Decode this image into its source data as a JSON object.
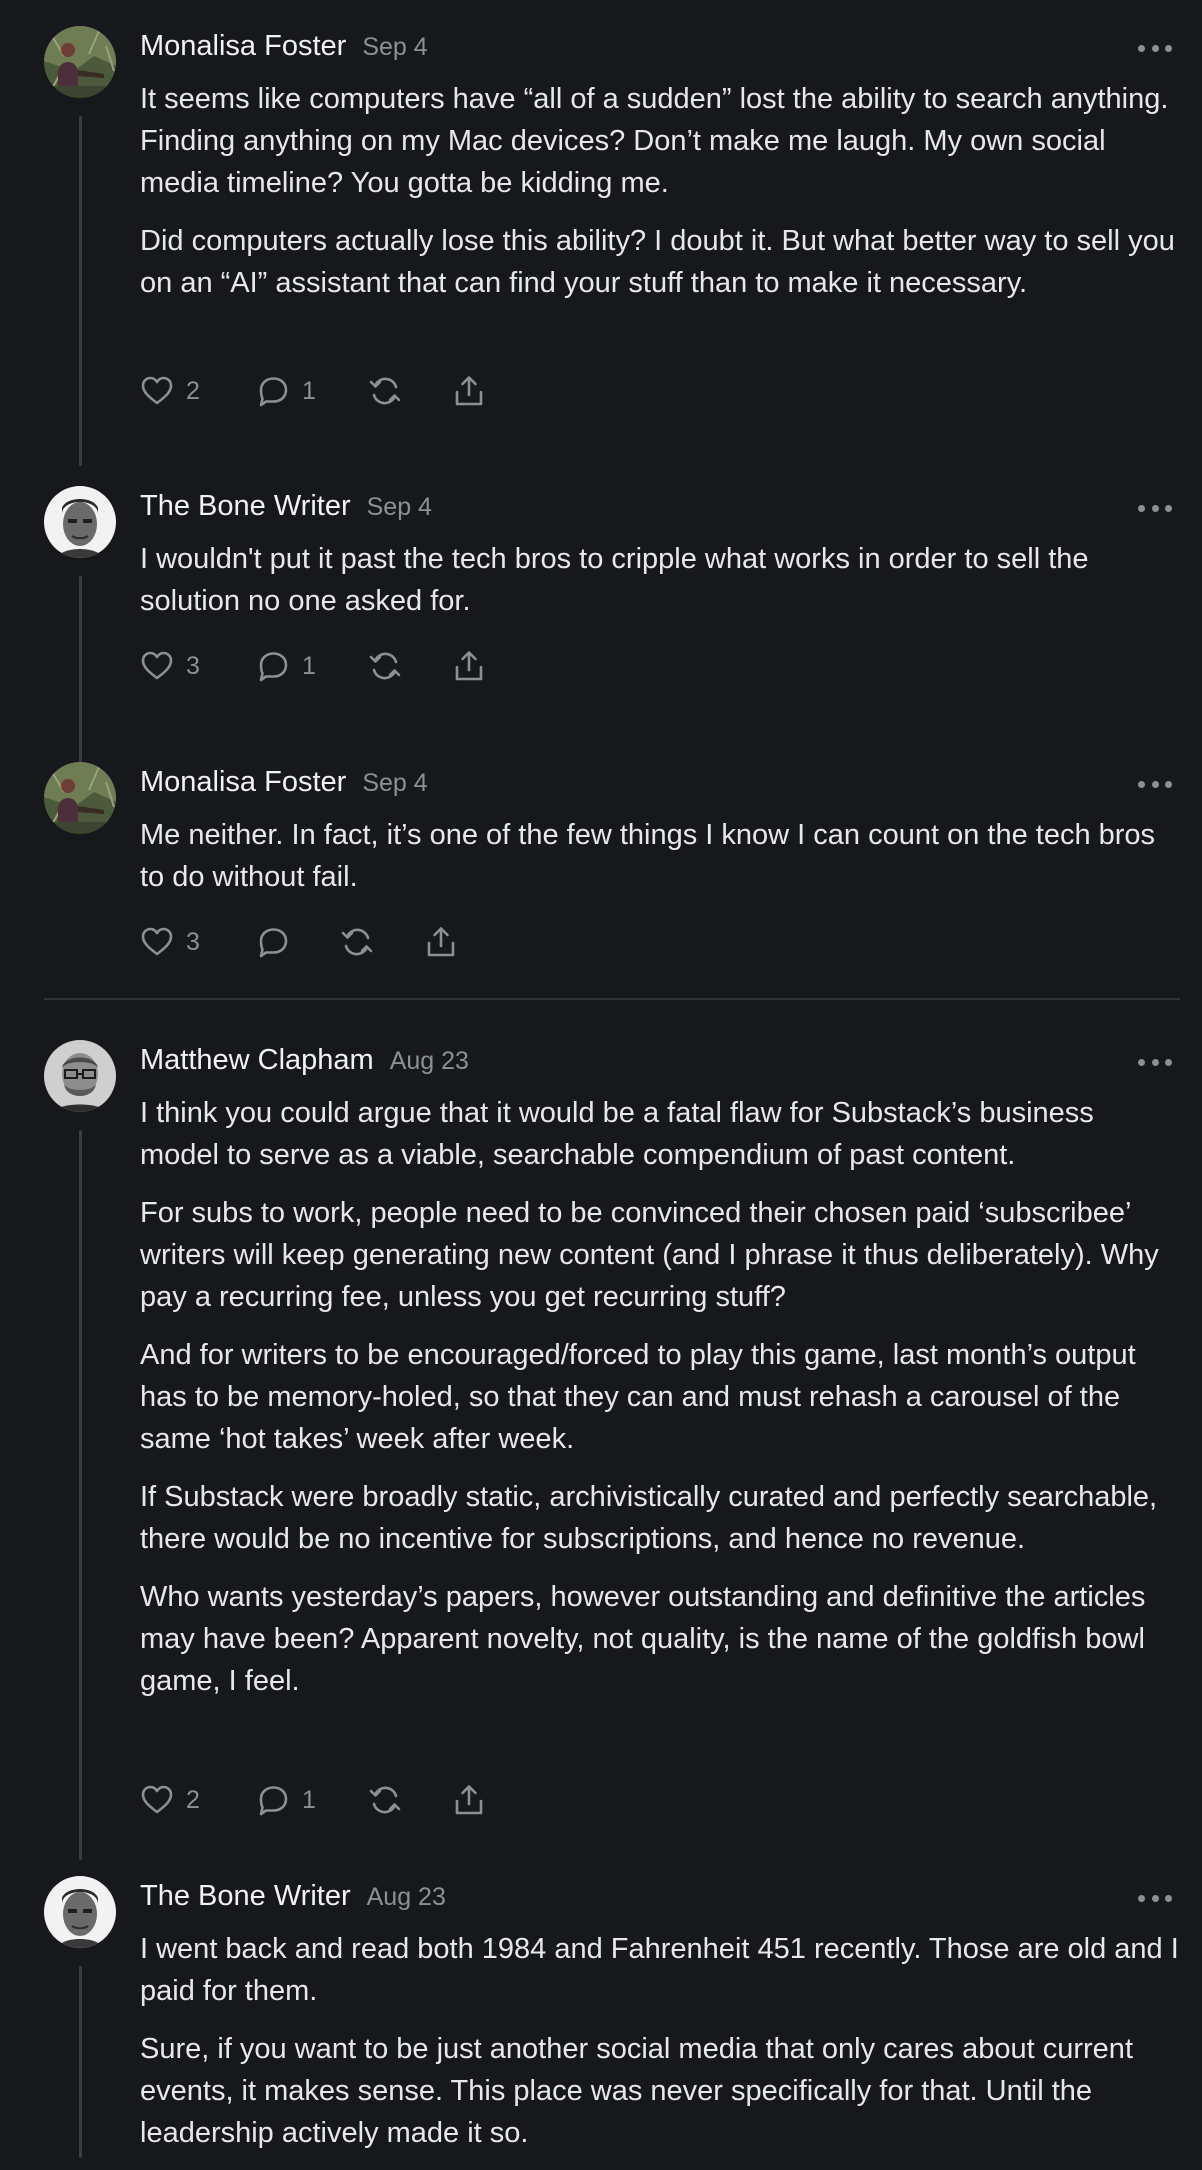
{
  "comments": [
    {
      "author": "Monalisa Foster",
      "date": "Sep 4",
      "paragraphs": [
        "It seems like computers have “all of a sudden” lost the ability to search anything. Finding anything on my Mac devices? Don’t make me laugh. My own social media timeline? You gotta be kidding me.",
        "Did computers actually lose this ability? I doubt it. But what better way to sell you on an “AI” assistant that can find your stuff than to make it necessary."
      ],
      "likes": "2",
      "replies": "1"
    },
    {
      "author": "The Bone Writer",
      "date": "Sep 4",
      "paragraphs": [
        "I wouldn't put it past the tech bros to cripple what works in order to sell the solution no one asked for."
      ],
      "likes": "3",
      "replies": "1"
    },
    {
      "author": "Monalisa Foster",
      "date": "Sep 4",
      "paragraphs": [
        "Me neither. In fact, it’s one of the few things I know I can count on the tech bros to do without fail."
      ],
      "likes": "3",
      "replies": ""
    },
    {
      "author": "Matthew Clapham",
      "date": "Aug 23",
      "paragraphs": [
        "I think you could argue that it would be a fatal flaw for Substack’s business model to serve as a viable, searchable compendium of past content.",
        "For subs to work, people need to be convinced their chosen paid ‘subscribee’ writers will keep generating new content (and I phrase it thus deliberately). Why pay a recurring fee, unless you get recurring stuff?",
        "And for writers to be encouraged/forced to play this game, last month’s output has to be memory-holed, so that they can and must rehash a carousel of the same ‘hot takes’ week after week.",
        "If Substack were broadly static, archivistically curated and perfectly searchable, there would be no incentive for subscriptions, and hence no revenue.",
        "Who wants yesterday’s papers, however outstanding and definitive the articles may have been? Apparent novelty, not quality, is the name of the goldfish bowl game, I feel."
      ],
      "likes": "2",
      "replies": "1"
    },
    {
      "author": "The Bone Writer",
      "date": "Aug 23",
      "paragraphs": [
        "I went back and read both 1984 and Fahrenheit 451 recently. Those are old and I paid for them.",
        "Sure, if you want to be just another social media that only cares about current events, it makes sense. This place was never specifically for that. Until the leadership actively made it so."
      ],
      "likes": "",
      "replies": ""
    }
  ],
  "icons": {
    "like": "heart-icon",
    "reply": "speech-bubble-icon",
    "restack": "restack-arrows-icon",
    "share": "share-upload-icon",
    "more": "ellipsis-icon"
  },
  "colors": {
    "background": "#17181b",
    "text": "#e7e8ea",
    "muted": "#8c8f95",
    "thread_line": "#3a3c40",
    "divider": "#2f3135"
  }
}
